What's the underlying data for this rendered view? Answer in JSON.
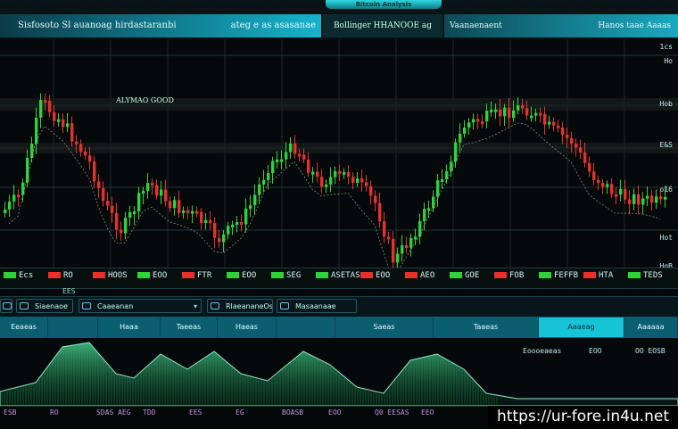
{
  "top_accent_label": "Bitcoin Analysis",
  "header": {
    "left_title": "Sisfosoto  Sl auanoag hirdastaranbi",
    "left_right_text": "ateg e  as  asasanae",
    "mid_title": "Bollinger HHANOOE ag",
    "right_title": "Vaanaenaent",
    "right_right_text": "Hanos taae  Aaaas"
  },
  "price_axis": [
    "1cs",
    "Ho",
    "Hob",
    "E&S",
    "o16",
    "Hot",
    "HgB"
  ],
  "chart_overlay_text": "ALYMAO GOOD",
  "ticker": [
    {
      "label": "Ecs",
      "color": "#2fd23a"
    },
    {
      "label": "RO",
      "color": "#e5322b"
    },
    {
      "label": "HOOS",
      "color": "#e5322b"
    },
    {
      "label": "EOO",
      "color": "#2fd23a"
    },
    {
      "label": "FTR",
      "color": "#e5322b"
    },
    {
      "label": "EOO",
      "color": "#2fd23a"
    },
    {
      "label": "SEG",
      "color": "#2fd23a"
    },
    {
      "label": "ASETAS",
      "color": "#2fd23a"
    },
    {
      "label": "EOO",
      "color": "#e5322b"
    },
    {
      "label": "AEO",
      "color": "#e5322b"
    },
    {
      "label": "GOE",
      "color": "#2fd23a"
    },
    {
      "label": "FOB",
      "color": "#e5322b"
    },
    {
      "label": "FEFFB",
      "color": "#2fd23a"
    },
    {
      "label": "HTA",
      "color": "#e5322b"
    },
    {
      "label": "TEDS",
      "color": "#2fd23a"
    }
  ],
  "ticker_sub": "EES",
  "toolbar": [
    {
      "label": "Siaenaoe"
    },
    {
      "label": "Caaeanan"
    },
    {
      "label": "RlaeananeOs"
    },
    {
      "label": "Masaanaae"
    }
  ],
  "tabs": [
    "Eeaeas",
    "",
    "Haaa",
    "Taeeas",
    "Haeas",
    "",
    "Saeas",
    "Taaeas",
    "Aaaeag",
    "Aaaaaa"
  ],
  "bottom_labels": [
    {
      "text": "Eoooeaeas",
      "color": "#e4a93a"
    },
    {
      "text": "EOO",
      "color": "#e5322b"
    },
    {
      "text": "OO EOSB",
      "color": "#2fd23a"
    }
  ],
  "footer": [
    "ESB",
    "RO",
    "SDAS AEG",
    "TDD",
    "EES",
    "EG",
    "BOASB",
    "EOO",
    "Q0 EESAS",
    "EEO"
  ],
  "watermark": "https://ur-fore.in4u.net",
  "colors": {
    "bull": "#2fd23a",
    "bear": "#e5322b",
    "accent": "#17c3d6"
  }
}
